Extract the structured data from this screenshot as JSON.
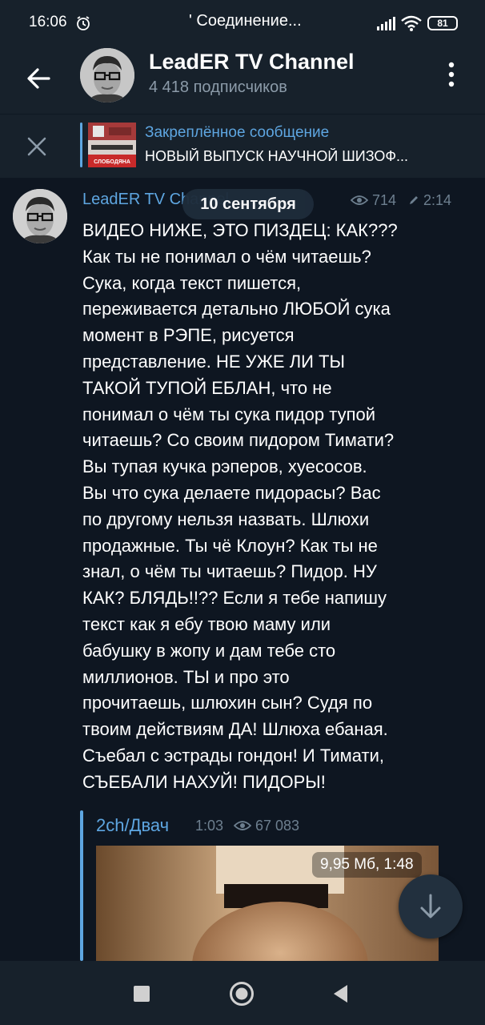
{
  "status_bar": {
    "time": "16:06",
    "connection": "' Соединение...",
    "battery": "81",
    "icons": [
      "alarm-icon",
      "signal-icon",
      "wifi-icon",
      "battery-icon"
    ]
  },
  "header": {
    "title": "LeadER TV Channel",
    "subscribers": "4 418 подписчиков",
    "icons": [
      "back-arrow-icon",
      "more-vert-icon"
    ]
  },
  "pinned": {
    "title": "Закреплённое сообщение",
    "text": "НОВЫЙ ВЫПУСК НАУЧНОЙ ШИЗОФ...",
    "thumb_caption": "СЛОБОДЯНА",
    "icons": [
      "close-icon"
    ]
  },
  "message": {
    "author": "LeadER TV Channel",
    "date_pill": "10 сентября",
    "views": "714",
    "time": "2:14",
    "text": "ВИДЕО НИЖЕ, ЭТО ПИЗДЕЦ: КАК???\nКак ты не понимал о чём читаешь?\nСука, когда текст пишется,\nпереживается детально ЛЮБОЙ сука\nмомент в РЭПЕ, рисуется\nпредставление. НЕ УЖЕ ЛИ ТЫ\nТАКОЙ ТУПОЙ ЕБЛАН, что не\nпонимал о чём ты сука пидор тупой\nчитаешь? Со своим пидором Тимати?\nВы тупая кучка рэперов, хуесосов.\nВы что сука делаете пидорасы? Вас\nпо другому нельзя назвать. Шлюхи\nпродажные. Ты чё Клоун? Как ты не\nзнал, о чём ты читаешь? Пидор. НУ\nКАК? БЛЯДЬ!!?? Если я тебе напишу\nтекст как я ебу твою маму или\nбабушку в жопу и дам тебе сто\nмиллионов. ТЫ и про это\nпрочитаешь, шлюхин сын? Судя по\nтвоим действиям ДА! Шлюха ебаная.\nСъебал с эстрады гондон! И Тимати,\nСЪЕБАЛИ НАХУЙ! ПИДОРЫ!",
    "icons": [
      "eye-icon",
      "pencil-icon"
    ]
  },
  "forwarded": {
    "author": "2ch/Двач",
    "time": "1:03",
    "views": "67 083",
    "video_info": "9,95 Мб, 1:48"
  },
  "floating": {
    "icon": "arrow-down-icon"
  },
  "nav_bar": {
    "icons": [
      "recents-icon",
      "home-icon",
      "back-icon"
    ]
  },
  "colors": {
    "background": "#0e1621",
    "bar": "#17212b",
    "accent": "#5ea6e1",
    "muted": "#6d7f8f"
  }
}
